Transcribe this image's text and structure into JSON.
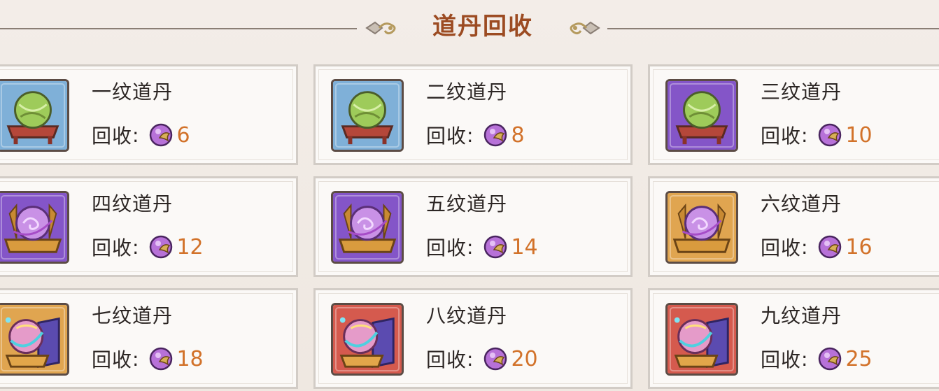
{
  "header": {
    "title": "道丹回收"
  },
  "colors": {
    "title": "#9c4b22",
    "amount": "#d2722a",
    "blue": "#7fb0d8",
    "purple": "#8455c8",
    "gold": "#e0a550",
    "red": "#d55a4e"
  },
  "recycle_label": "回收",
  "recycle_colon": ":",
  "items": [
    {
      "name": "一纹道丹",
      "amount": "6",
      "bg": "blue",
      "icon": "green-orb-icon"
    },
    {
      "name": "二纹道丹",
      "amount": "8",
      "bg": "blue",
      "icon": "green-orb-icon"
    },
    {
      "name": "三纹道丹",
      "amount": "10",
      "bg": "purple",
      "icon": "green-orb-icon"
    },
    {
      "name": "四纹道丹",
      "amount": "12",
      "bg": "purple",
      "icon": "purple-orb-icon"
    },
    {
      "name": "五纹道丹",
      "amount": "14",
      "bg": "purple",
      "icon": "purple-orb-icon"
    },
    {
      "name": "六纹道丹",
      "amount": "16",
      "bg": "gold",
      "icon": "purple-orb-icon"
    },
    {
      "name": "七纹道丹",
      "amount": "18",
      "bg": "gold",
      "icon": "rainbow-orb-icon"
    },
    {
      "name": "八纹道丹",
      "amount": "20",
      "bg": "red",
      "icon": "rainbow-orb-icon"
    },
    {
      "name": "九纹道丹",
      "amount": "25",
      "bg": "red",
      "icon": "rainbow-orb-icon"
    }
  ]
}
